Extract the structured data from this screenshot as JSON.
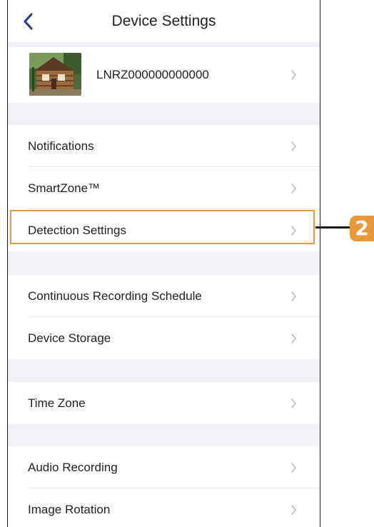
{
  "header": {
    "title": "Device Settings",
    "back_icon": "chevron-left-icon"
  },
  "device": {
    "name": "LNRZ000000000000"
  },
  "groups": [
    {
      "items": [
        {
          "label": "Notifications"
        },
        {
          "label": "SmartZone™"
        },
        {
          "label": "Detection Settings"
        }
      ]
    },
    {
      "items": [
        {
          "label": "Continuous Recording Schedule"
        },
        {
          "label": "Device Storage"
        }
      ]
    },
    {
      "items": [
        {
          "label": "Time Zone"
        }
      ]
    },
    {
      "items": [
        {
          "label": "Audio Recording"
        },
        {
          "label": "Image Rotation"
        }
      ]
    }
  ],
  "callout": {
    "number": "2",
    "target": "Detection Settings"
  },
  "colors": {
    "accent": "#1f3a93",
    "highlight": "#e8973a",
    "section_gap": "#f0f2f8",
    "chevron": "#b8bcc6"
  }
}
